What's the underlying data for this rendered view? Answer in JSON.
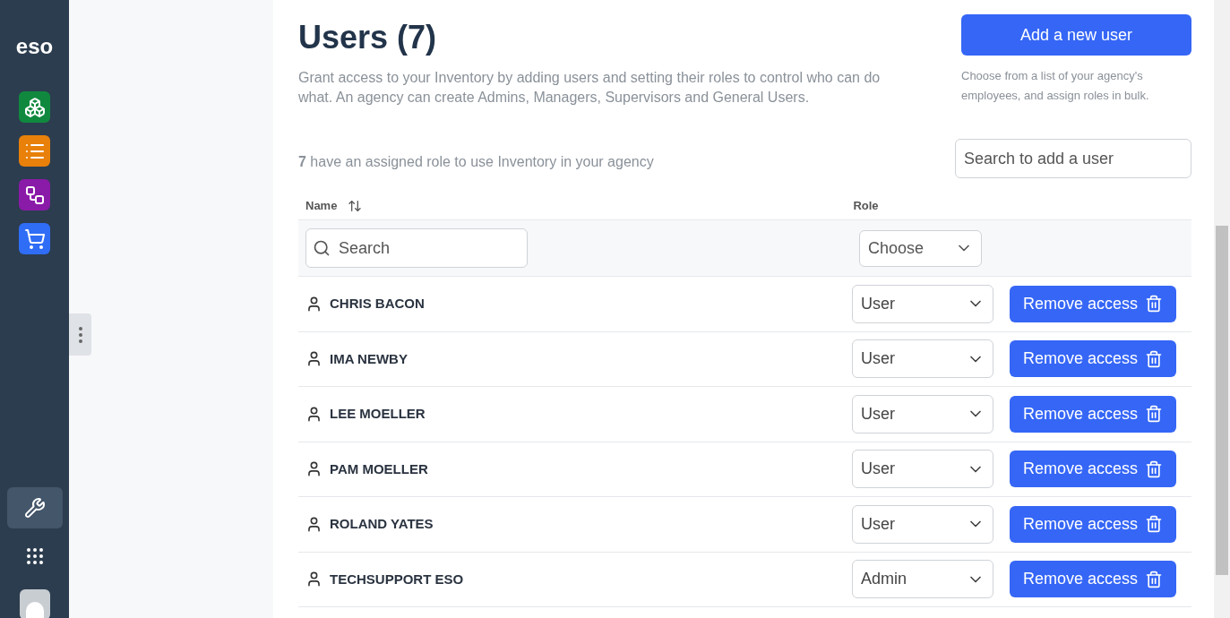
{
  "sidebar": {
    "logo": "eso",
    "apps": [
      {
        "kind": "boxes",
        "color": "#10893e",
        "selected": false
      },
      {
        "kind": "list",
        "color": "#e8800a",
        "selected": false
      },
      {
        "kind": "flow",
        "color": "#8a1aa8",
        "selected": false
      },
      {
        "kind": "cart",
        "color": "#2f6df6",
        "selected": false
      }
    ],
    "tools": [
      {
        "kind": "wrench",
        "selected": true
      },
      {
        "kind": "grid",
        "selected": false
      },
      {
        "kind": "avatar",
        "selected": false
      }
    ]
  },
  "header": {
    "title": "Users (7)",
    "description": "Grant access to your Inventory by adding users and setting their roles to control who can do what. An agency can create Admins, Managers, Supervisors and General Users.",
    "add_button": "Add a new user",
    "add_hint": "Choose from a list of your agency's employees, and assign roles in bulk."
  },
  "summary": "**7** have an assigned role to use Inventory in your agency",
  "add_search": {
    "placeholder": "Search to add a user"
  },
  "table": {
    "columns": [
      "Name",
      "Role"
    ],
    "filters": {
      "name_placeholder": "Search",
      "role_placeholder": "Choose"
    },
    "rows": [
      {
        "name": "CHRIS BACON",
        "role": "User",
        "action": "Remove access"
      },
      {
        "name": "IMA NEWBY",
        "role": "User",
        "action": "Remove access"
      },
      {
        "name": "LEE MOELLER",
        "role": "User",
        "action": "Remove access"
      },
      {
        "name": "PAM MOELLER",
        "role": "User",
        "action": "Remove access"
      },
      {
        "name": "ROLAND YATES",
        "role": "User",
        "action": "Remove access"
      },
      {
        "name": "TECHSUPPORT ESO",
        "role": "Admin",
        "action": "Remove access"
      }
    ]
  }
}
